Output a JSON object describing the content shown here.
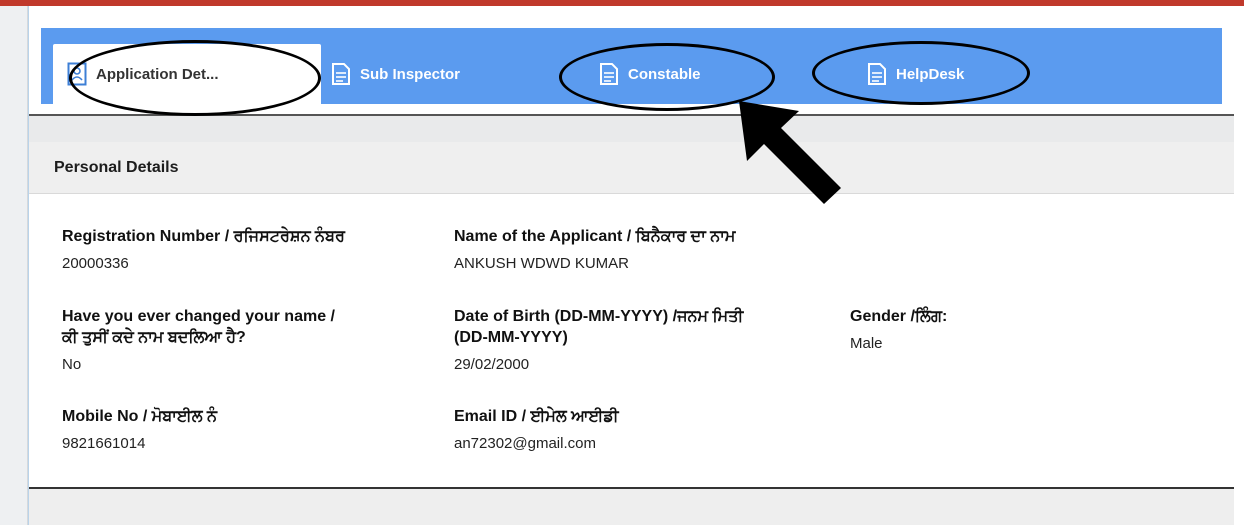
{
  "tabs": [
    {
      "label": "Application Det...",
      "icon": "user-form-icon",
      "active": true
    },
    {
      "label": "Sub Inspector",
      "icon": "document-icon",
      "active": false
    },
    {
      "label": "Constable",
      "icon": "document-icon",
      "active": false
    },
    {
      "label": "HelpDesk",
      "icon": "document-icon",
      "active": false
    }
  ],
  "personal": {
    "title": "Personal Details",
    "registration": {
      "label": "Registration Number / ਰਜਿਸਟਰੇਸ਼ਨ ਨੰਬਰ",
      "value": "20000336"
    },
    "applicant": {
      "label": "Name of the Applicant / ਬਿਨੈਕਾਰ ਦਾ ਨਾਮ",
      "value": "ANKUSH WDWD KUMAR"
    },
    "name_changed": {
      "label_line1": "Have you ever changed your name /",
      "label_line2": "ਕੀ ਤੁਸੀਂ ਕਦੇ ਨਾਮ ਬਦਲਿਆ ਹੈ?",
      "value": "No"
    },
    "dob": {
      "label_line1": "Date of Birth (DD-MM-YYYY) /ਜਨਮ ਮਿਤੀ",
      "label_line2": "(DD-MM-YYYY)",
      "value": "29/02/2000"
    },
    "gender": {
      "label": "Gender /ਲਿੰਗ:",
      "value": "Male"
    },
    "mobile": {
      "label": "Mobile No / ਮੋਬਾਈਲ ਨੰ",
      "value": "9821661014"
    },
    "email": {
      "label": "Email ID / ਈਮੇਲ ਆਈਡੀ",
      "value": "an72302@gmail.com"
    }
  },
  "colors": {
    "accent_red": "#c0392b",
    "tab_blue": "#5b9bef",
    "annotation": "#000000"
  }
}
